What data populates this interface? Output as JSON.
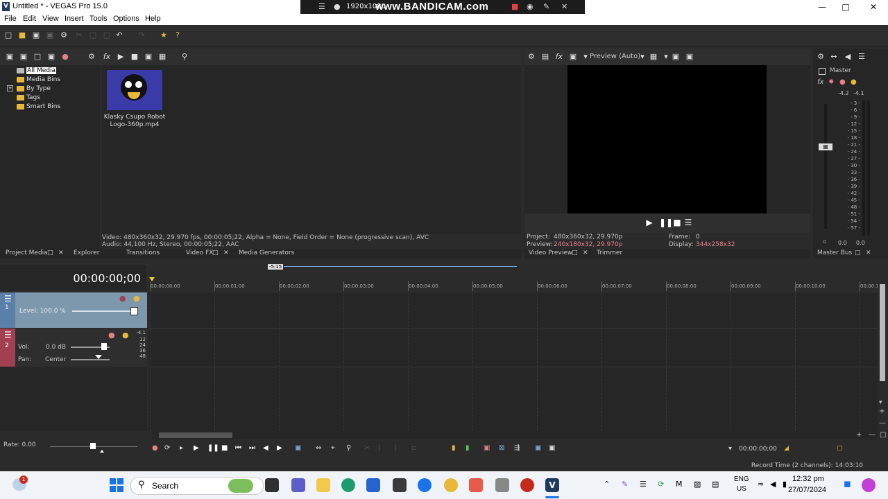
{
  "window": {
    "title": "Untitled * - VEGAS Pro 15.0",
    "logo": "V"
  },
  "recorder": {
    "resolution": "1920x1080",
    "brand": "www.BANDICAM.com"
  },
  "menu": [
    "File",
    "Edit",
    "View",
    "Insert",
    "Tools",
    "Options",
    "Help"
  ],
  "project_media": {
    "tree": [
      "All Media",
      "Media Bins",
      "By Type",
      "Tags",
      "Smart Bins"
    ],
    "media_item": "Klasky Csupo Robot Logo-360p.mp4",
    "info_video": "Video: 480x360x32, 29.970 fps, 00:00:05;22, Alpha = None, Field Order = None (progressive scan), AVC",
    "info_audio": "Audio: 44,100 Hz, Stereo, 00:00:05;22, AAC",
    "tabs": [
      "Project Media",
      "Explorer",
      "Transitions",
      "Video FX",
      "Media Generators"
    ]
  },
  "preview": {
    "mode": "Preview (Auto)",
    "project_label": "Project:",
    "project_value": "480x360x32, 29.970p",
    "preview_label": "Preview:",
    "preview_value": "240x180x32, 29.970p",
    "frame_label": "Frame:",
    "frame_value": "0",
    "display_label": "Display:",
    "display_value": "344x258x32",
    "tabs": [
      "Video Preview",
      "Trimmer"
    ]
  },
  "master": {
    "label": "Master",
    "peak_left": "-4.2",
    "peak_right": "-4.1",
    "scale": [
      "3",
      "6",
      "9",
      "12",
      "15",
      "18",
      "21",
      "24",
      "27",
      "30",
      "33",
      "36",
      "39",
      "42",
      "45",
      "48",
      "51",
      "54",
      "57"
    ],
    "bottom_left": "0.0",
    "bottom_right": "0.0",
    "tab": "Master Bus"
  },
  "timeline": {
    "timecode": "00:00:00;00",
    "marker": "-5:15",
    "ruler": [
      "00:00:00:00",
      "00:00:01:00",
      "00:00:02:00",
      "00:00:03:00",
      "00:00:04:00",
      "00:00:05:00",
      "00:00:06:00",
      "00:00:07:00",
      "00:00:08:00",
      "00:00:09:00",
      "00:00:10:00",
      "00:00:1"
    ],
    "track1": {
      "num": "1",
      "level": "Level: 100.0 %"
    },
    "track2": {
      "num": "2",
      "vol_label": "Vol:",
      "vol_value": "0.0 dB",
      "pan_label": "Pan:",
      "pan_value": "Center",
      "meter": [
        "-4.1",
        "12",
        "24",
        "36",
        "48"
      ]
    },
    "rate": "Rate: 0.00",
    "end_timecode": "00:00:00;00",
    "record_time": "Record Time (2 channels): 14:03:10"
  },
  "taskbar": {
    "search": "Search",
    "lang1": "ENG",
    "lang2": "US",
    "time": "12:32 pm",
    "date": "27/07/2024",
    "badge": "1"
  },
  "colors": {
    "accent_pink": "#e8808a",
    "track1": "#7d98ad",
    "track2_tag": "#a04050",
    "track1_tag": "#5a7fa8"
  }
}
